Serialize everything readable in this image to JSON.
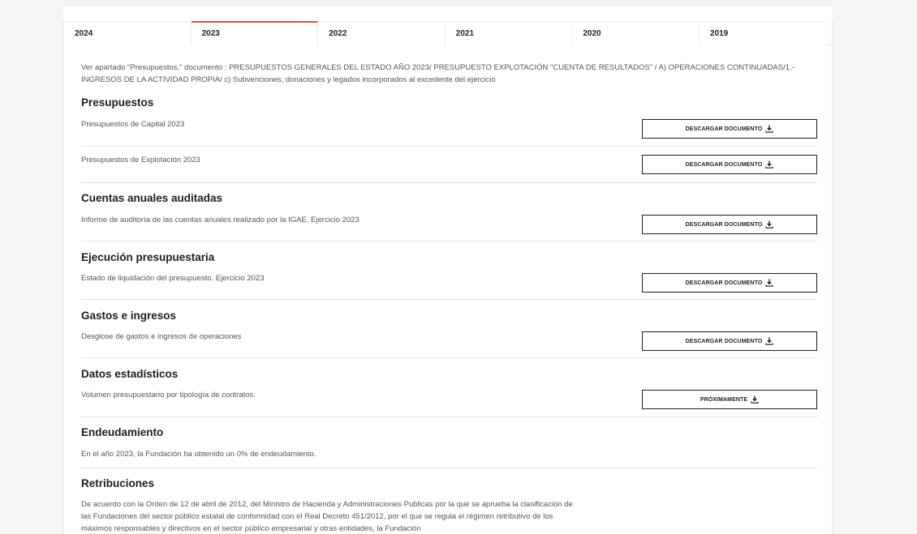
{
  "tabs": [
    {
      "label": "2024"
    },
    {
      "label": "2023"
    },
    {
      "label": "2022"
    },
    {
      "label": "2021"
    },
    {
      "label": "2020"
    },
    {
      "label": "2019"
    }
  ],
  "active_tab": "2023",
  "intro": "Ver apartado \"Presupuestos,\" documento : PRESUPUESTOS GENERALES DEL ESTADO AÑO 2023/ PRESUPUESTO EXPLOTACIÓN \"CUENTA DE RESULTADOS\" / A) OPERACIONES CONTINUADAS/1.- INGRESOS DE LA ACTIVIDAD PROPIA/ c) Subvenciones, donaciones y legados incorporados al excedente del ejercicio",
  "sections": {
    "presupuestos": {
      "title": "Presupuestos",
      "items": [
        {
          "desc": "Presupuestos de Capital 2023",
          "button": "DESCARGAR DOCUMENTO"
        },
        {
          "desc": "Presupuestos de Explotación 2023",
          "button": "DESCARGAR DOCUMENTO"
        }
      ]
    },
    "cuentas": {
      "title": "Cuentas anuales auditadas",
      "desc": "Informe de auditoría de las cuentas anuales realizado por la IGAE. Ejercicio 2023",
      "button": "DESCARGAR DOCUMENTO"
    },
    "ejecucion": {
      "title": "Ejecución presupuestaria",
      "desc": "Estado de liquidación del presupuesto. Ejercicio 2023",
      "button": "DESCARGAR DOCUMENTO"
    },
    "gastos": {
      "title": "Gastos e ingresos",
      "desc": "Desglose de gastos e ingresos de operaciones",
      "button": "DESCARGAR DOCUMENTO"
    },
    "datos": {
      "title": "Datos estadísticos",
      "desc": "Volumen presupuestario por tipología de contratos.",
      "button": "PRÓXIMAMENTE"
    },
    "endeudamiento": {
      "title": "Endeudamiento",
      "desc": "En el año 2023, la Fundación ha obtenido un 0% de endeudamiento."
    },
    "retribuciones": {
      "title": "Retribuciones",
      "desc": "De acuerdo con la Orden de 12 de abril de 2012, del Ministro de Hacienda y Administraciones Publicas por la que se aprueba la clasificación de las Fundaciones del sector público estatal de conformidad con el Real Decreto 451/2012, por el que se regula el régimen retributivo de los máximos responsables y directivos en el sector público empresarial y otras entidades, la Fundación"
    }
  },
  "icons": {
    "download": "download-icon"
  },
  "colors": {
    "active_tab_border": "#d9534f",
    "heading": "#1e1e1e",
    "text": "#555555"
  }
}
